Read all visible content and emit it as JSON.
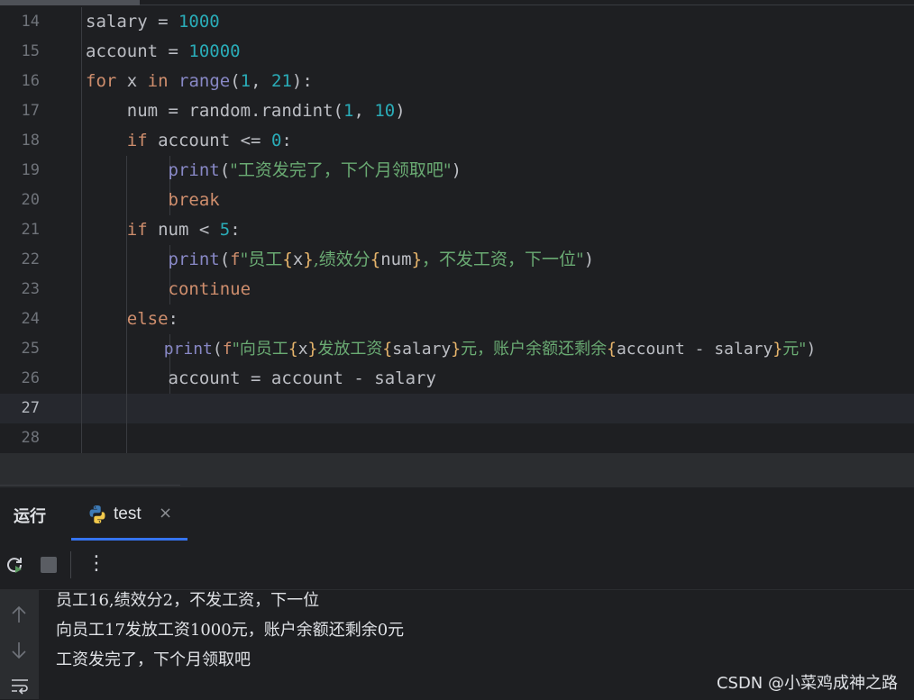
{
  "editor": {
    "line_numbers": [
      "14",
      "15",
      "16",
      "17",
      "18",
      "19",
      "20",
      "21",
      "22",
      "23",
      "24",
      "25",
      "26",
      "27",
      "28"
    ],
    "current_line": "27",
    "code": {
      "l14": {
        "a": "salary = ",
        "b": "1000"
      },
      "l15": {
        "a": "account = ",
        "b": "10000"
      },
      "l16": {
        "kw1": "for",
        "a": " x ",
        "kw2": "in",
        "a2": " ",
        "fn": "range",
        "p1": "(",
        "n1": "1",
        "c": ", ",
        "n2": "21",
        "p2": "):"
      },
      "l17": {
        "a": "num = random.randint(",
        "n1": "1",
        "c": ", ",
        "n2": "10",
        "p": ")"
      },
      "l18": {
        "kw": "if",
        "a": " account <= ",
        "n": "0",
        "p": ":"
      },
      "l19": {
        "fn": "print",
        "p1": "(",
        "s": "\"工资发完了，下个月领取吧\"",
        "p2": ")"
      },
      "l20": {
        "kw": "break"
      },
      "l21": {
        "kw": "if",
        "a": " num < ",
        "n": "5",
        "p": ":"
      },
      "l22": {
        "fn": "print",
        "p1": "(",
        "f": "f",
        "s1": "\"员工",
        "b1": "{",
        "v1": "x",
        "b2": "}",
        "s2": ",绩效分",
        "b3": "{",
        "v2": "num",
        "b4": "}",
        "s3": "，不发工资，下一位\"",
        "p2": ")"
      },
      "l23": {
        "kw": "continue"
      },
      "l24": {
        "kw": "else",
        "p": ":"
      },
      "l25": {
        "fn": "print",
        "p1": "(",
        "f": "f",
        "s1": "\"向员工",
        "b1": "{",
        "v1": "x",
        "b2": "}",
        "s2": "发放工资",
        "b3": "{",
        "v2": "salary",
        "b4": "}",
        "s3": "元，账户余额还剩余",
        "b5": "{",
        "v3": "account - salary",
        "b6": "}",
        "s4": "元\"",
        "p2": ")"
      },
      "l26": {
        "a": "account = account - salary"
      }
    }
  },
  "run_panel": {
    "title": "运行",
    "tab_label": "test",
    "tab_close": "×",
    "toolbar": {
      "rerun_icon": "rerun-icon",
      "stop_icon": "stop-icon",
      "more": "⋮"
    },
    "side": {
      "up": "↑",
      "down": "↓"
    },
    "output": [
      "员工16,绩效分2，不发工资，下一位",
      "向员工17发放工资1000元，账户余额还剩余0元",
      "工资发完了，下个月领取吧"
    ]
  },
  "watermark": "CSDN @小菜鸡成神之路",
  "colors": {
    "keyword": "#cf8e6d",
    "number": "#2aacb8",
    "string": "#6aab73",
    "builtin": "#8888c6",
    "brace": "#e7b56c",
    "accent": "#3574f0"
  }
}
